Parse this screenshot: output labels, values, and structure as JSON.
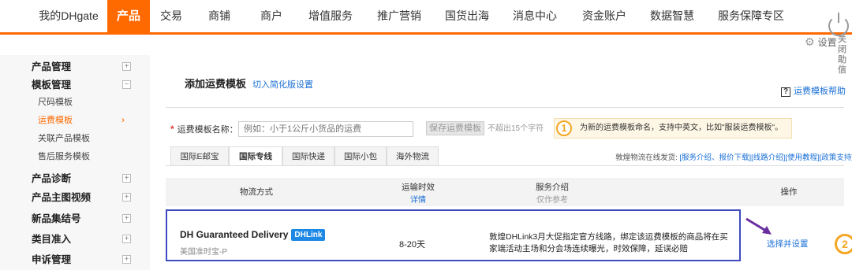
{
  "nav": {
    "items": [
      "我的DHgate",
      "产品",
      "交易",
      "商铺",
      "商户",
      "增值服务",
      "推广营销",
      "国货出海",
      "消息中心",
      "资金账户",
      "数据智慧",
      "服务保障专区"
    ],
    "active_index": 1,
    "close_label": "关闭助信"
  },
  "settings": {
    "label": "设置",
    "icon": "gear-icon"
  },
  "sidebar": {
    "items": [
      {
        "label": "产品管理",
        "type": "head",
        "toggle": "+"
      },
      {
        "label": "模板管理",
        "type": "head",
        "toggle": "−"
      },
      {
        "label": "尺码模板",
        "type": "sub"
      },
      {
        "label": "运费模板",
        "type": "sub",
        "active": true
      },
      {
        "label": "关联产品模板",
        "type": "sub"
      },
      {
        "label": "售后服务模板",
        "type": "sub"
      },
      {
        "label": "产品诊断",
        "type": "head",
        "toggle": "+"
      },
      {
        "label": "产品主图视频",
        "type": "head",
        "toggle": "+"
      },
      {
        "label": "新品集结号",
        "type": "head",
        "toggle": "+"
      },
      {
        "label": "类目准入",
        "type": "head",
        "toggle": "+"
      },
      {
        "label": "申诉管理",
        "type": "head",
        "toggle": "+"
      }
    ],
    "active_chevron": "›"
  },
  "main": {
    "title": "添加运费模板",
    "switch_link": "切入简化版设置",
    "help_link": "运费模板帮助",
    "name_label": "运费模板名称：",
    "name_placeholder": "例如：小于1公斤小货品的运费",
    "save_button": "保存运费模板",
    "limit_text": "不超出15个字符",
    "tip_number": "1",
    "tip_text": "为新的运费模板命名，支持中英文，比如\"服装运费模板\"。",
    "tabs": [
      "国际E邮宝",
      "国际专线",
      "国际快递",
      "国际小包",
      "海外物流"
    ],
    "active_tab": 1,
    "links_prefix": "敦煌物流在线发货: ",
    "links": [
      "[服务介绍、报价下载]",
      "[线路介绍]",
      "[使用教程]",
      "[政策支持]"
    ],
    "table": {
      "headers": {
        "method": "物流方式",
        "time": "运输时效",
        "time_sub": "详情",
        "service": "服务介绍",
        "service_sub": "仅作参考",
        "action": "操作"
      },
      "row": {
        "carrier": "DH Guaranteed Delivery",
        "badge": "DHLink",
        "carrier_sub": "美国准时宝-P",
        "time": "8-20天",
        "desc": "敦煌DHLink3月大促指定官方线路，绑定该运费模板的商品将在买家端活动主场和分会场连续曝光，时效保障，延误必赔",
        "action": "选择并设置"
      }
    },
    "step_badge": "2"
  },
  "colors": {
    "accent": "#ff6a00",
    "link": "#1a6fd6",
    "highlight_border": "#3d4bbf",
    "arrow": "#6a2ea0"
  }
}
